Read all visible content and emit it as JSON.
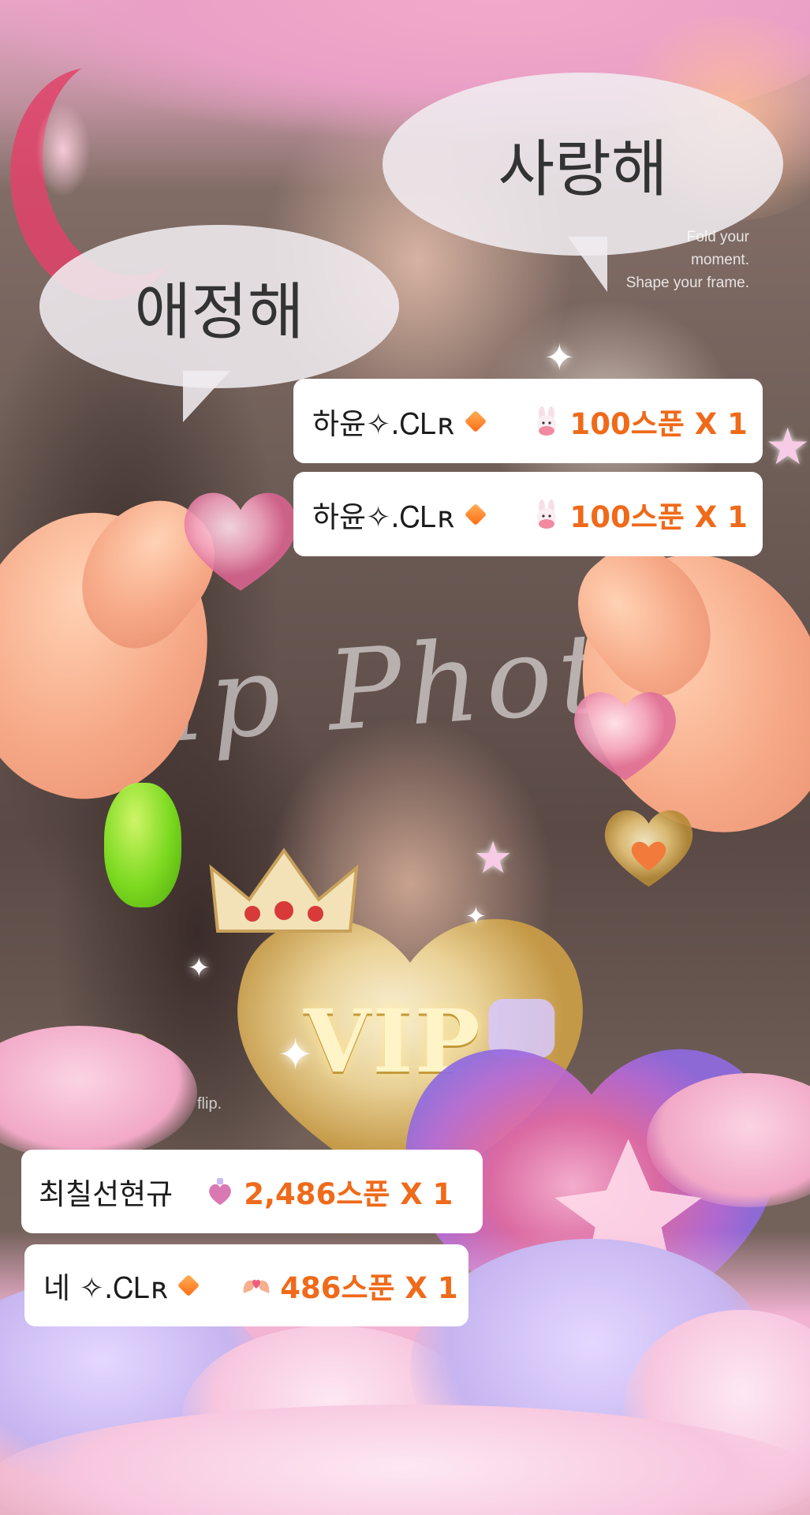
{
  "speech_bubbles": [
    {
      "text": "사랑해"
    },
    {
      "text": "애정해"
    }
  ],
  "frame_caption": {
    "line1": "Fold your",
    "line2": "moment.",
    "line3": "Shape your frame."
  },
  "script_overlay": "flip Phot",
  "vip_label": "VIP",
  "watermark": "flip.",
  "gift_notifications": [
    {
      "sender": "하윤✧.ᏟᏞʀ",
      "sender_badge": "orange-diamond-icon",
      "gift_icon": "bunny-sticker-icon",
      "amount": "100스푼 X 1"
    },
    {
      "sender": "하윤✧.ᏟᏞʀ",
      "sender_badge": "orange-diamond-icon",
      "gift_icon": "bunny-sticker-icon",
      "amount": "100스푼 X 1"
    },
    {
      "sender": "최칠선현규",
      "sender_badge": "",
      "gift_icon": "potion-heart-icon",
      "amount": "2,486스푼 X 1"
    },
    {
      "sender": "네 ✧.ᏟᏞʀ",
      "sender_badge": "orange-diamond-icon",
      "gift_icon": "heart-hands-icon",
      "amount": "486스푼 X 1"
    }
  ],
  "colors": {
    "amount_text": "#ef6a1a",
    "card_background": "#ffffff",
    "badge_diamond": "#ff7a1f"
  }
}
